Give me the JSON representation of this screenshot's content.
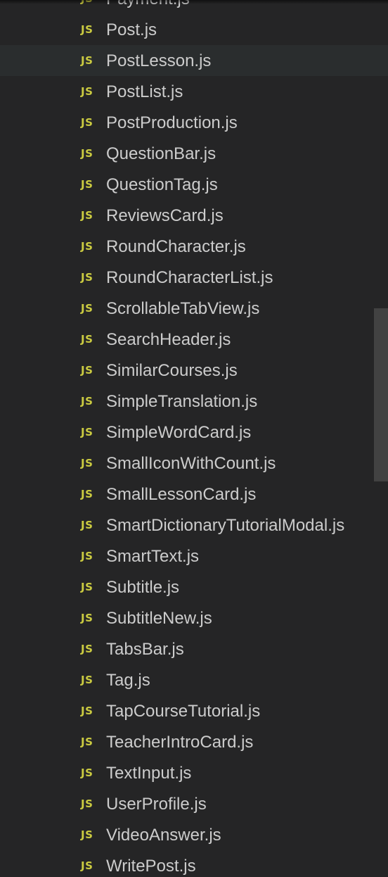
{
  "explorer": {
    "icon_label": "JS",
    "icon_color": "#cbcb41",
    "text_color": "#cccccc",
    "background": "#252526",
    "selected_background": "#2a2d2e",
    "scroll_position": 0.52,
    "files": [
      {
        "name": "Payment.js"
      },
      {
        "name": "Post.js"
      },
      {
        "name": "PostLesson.js",
        "selected": true
      },
      {
        "name": "PostList.js"
      },
      {
        "name": "PostProduction.js"
      },
      {
        "name": "QuestionBar.js"
      },
      {
        "name": "QuestionTag.js"
      },
      {
        "name": "ReviewsCard.js"
      },
      {
        "name": "RoundCharacter.js"
      },
      {
        "name": "RoundCharacterList.js"
      },
      {
        "name": "ScrollableTabView.js"
      },
      {
        "name": "SearchHeader.js"
      },
      {
        "name": "SimilarCourses.js"
      },
      {
        "name": "SimpleTranslation.js"
      },
      {
        "name": "SimpleWordCard.js"
      },
      {
        "name": "SmallIconWithCount.js"
      },
      {
        "name": "SmallLessonCard.js"
      },
      {
        "name": "SmartDictionaryTutorialModal.js"
      },
      {
        "name": "SmartText.js"
      },
      {
        "name": "Subtitle.js"
      },
      {
        "name": "SubtitleNew.js"
      },
      {
        "name": "TabsBar.js"
      },
      {
        "name": "Tag.js"
      },
      {
        "name": "TapCourseTutorial.js"
      },
      {
        "name": "TeacherIntroCard.js"
      },
      {
        "name": "TextInput.js"
      },
      {
        "name": "UserProfile.js"
      },
      {
        "name": "VideoAnswer.js"
      },
      {
        "name": "WritePost.js"
      }
    ]
  }
}
